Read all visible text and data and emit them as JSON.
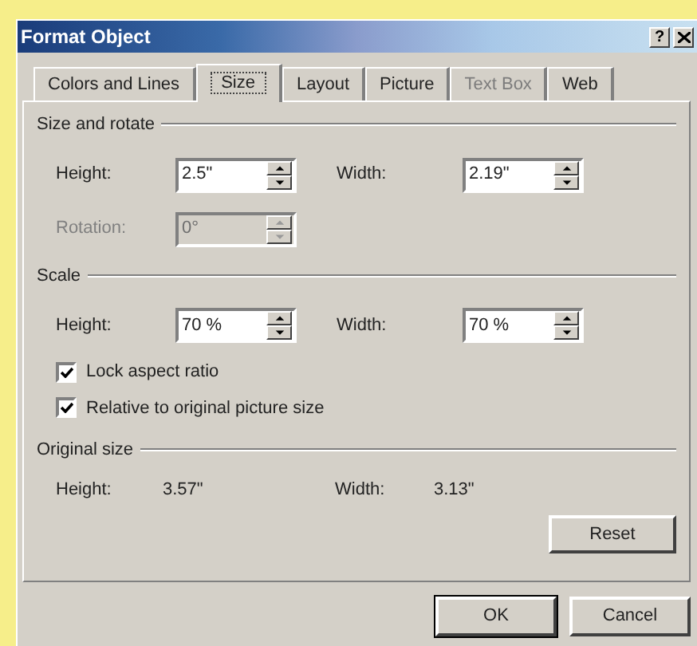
{
  "window": {
    "title": "Format Object",
    "help_button": "?"
  },
  "tabs": [
    {
      "label": "Colors and Lines",
      "selected": false,
      "disabled": false
    },
    {
      "label": "Size",
      "selected": true,
      "disabled": false
    },
    {
      "label": "Layout",
      "selected": false,
      "disabled": false
    },
    {
      "label": "Picture",
      "selected": false,
      "disabled": false
    },
    {
      "label": "Text Box",
      "selected": false,
      "disabled": true
    },
    {
      "label": "Web",
      "selected": false,
      "disabled": false
    }
  ],
  "sections": [
    {
      "title": "Size and rotate",
      "rows": [
        {
          "kind": "fields",
          "fields": [
            {
              "label": "Height:",
              "value": "2.5\"",
              "disabled": false
            },
            {
              "label": "Width:",
              "value": "2.19\"",
              "disabled": false
            }
          ]
        },
        {
          "kind": "fields",
          "fields": [
            {
              "label": "Rotation:",
              "value": "0°",
              "disabled": true
            }
          ]
        }
      ]
    },
    {
      "title": "Scale",
      "rows": [
        {
          "kind": "fields",
          "fields": [
            {
              "label": "Height:",
              "value": "70 %",
              "disabled": false
            },
            {
              "label": "Width:",
              "value": "70 %",
              "disabled": false
            }
          ]
        },
        {
          "kind": "checkbox",
          "label": "Lock aspect ratio",
          "checked": true
        },
        {
          "kind": "checkbox",
          "label": "Relative to original picture size",
          "checked": true
        }
      ]
    },
    {
      "title": "Original size",
      "rows": [
        {
          "kind": "readout",
          "items": [
            {
              "label": "Height:",
              "value": "3.57\""
            },
            {
              "label": "Width:",
              "value": "3.13\""
            }
          ]
        },
        {
          "kind": "button",
          "label": "Reset"
        }
      ]
    }
  ],
  "buttons": [
    {
      "label": "OK",
      "default": true
    },
    {
      "label": "Cancel",
      "default": false
    }
  ]
}
